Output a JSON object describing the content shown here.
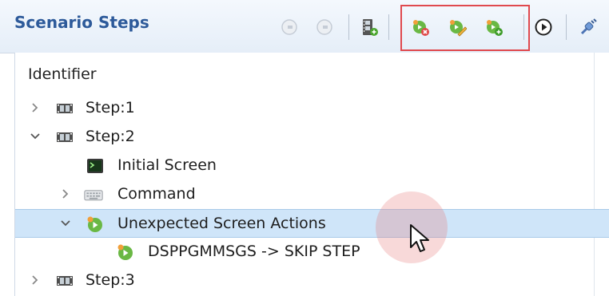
{
  "panel": {
    "title": "Scenario Steps"
  },
  "toolbar": [
    {
      "name": "step-back-button",
      "icon": "circle-minus-icon",
      "enabled": false
    },
    {
      "name": "step-over-button",
      "icon": "circle-minus-icon",
      "enabled": false
    },
    {
      "name": "add-step-button",
      "icon": "film-add-icon"
    },
    {
      "name": "delete-action-button",
      "icon": "action-delete-icon"
    },
    {
      "name": "edit-action-button",
      "icon": "action-edit-icon"
    },
    {
      "name": "add-action-button",
      "icon": "action-add-icon"
    },
    {
      "name": "run-button",
      "icon": "play-circle-icon"
    },
    {
      "name": "connect-button",
      "icon": "plug-icon"
    }
  ],
  "tree": {
    "column_header": "Identifier",
    "rows": [
      {
        "label": "Step:1",
        "expanded": false,
        "icon": "film-icon"
      },
      {
        "label": "Step:2",
        "expanded": true,
        "icon": "film-icon"
      },
      {
        "label": "Initial Screen",
        "icon": "terminal-icon"
      },
      {
        "label": "Command",
        "expanded": false,
        "icon": "keyboard-icon"
      },
      {
        "label": "Unexpected Screen Actions",
        "expanded": true,
        "icon": "action-icon",
        "selected": true
      },
      {
        "label": "DSPPGMMSGS -> SKIP STEP",
        "icon": "action-icon"
      },
      {
        "label": "Step:3",
        "expanded": false,
        "icon": "film-icon"
      }
    ]
  },
  "colors": {
    "title": "#2d5a9a",
    "selection": "#cfe5f9",
    "highlight_border": "#e0494e"
  }
}
